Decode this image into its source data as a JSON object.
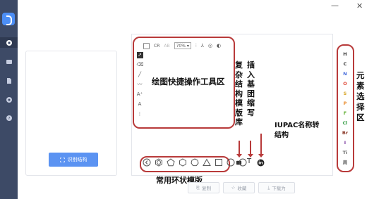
{
  "window": {
    "minimize_label": "—",
    "close_label": "✕"
  },
  "nav": {
    "items": [
      "home-icon",
      "folder-icon",
      "file-icon",
      "gear-icon",
      "help-icon"
    ]
  },
  "left_panel": {
    "recognize_button": "识别结构"
  },
  "editor": {
    "zoom": "70%",
    "elements": [
      "H",
      "C",
      "N",
      "O",
      "S",
      "P",
      "F",
      "Cl",
      "Br",
      "I",
      "Ti",
      "周"
    ],
    "element_colors": {
      "H": "#333333",
      "C": "#333333",
      "N": "#3a62d8",
      "O": "#e04a3a",
      "S": "#d6a322",
      "P": "#e98a2a",
      "F": "#66b23a",
      "Cl": "#3aa04a",
      "Br": "#8b3a2a",
      "I": "#7a3aa0",
      "Ti": "#666666",
      "周": "#666666"
    }
  },
  "annotations": {
    "toolbar": "绘图快捷操作工具区",
    "template_lib": "复杂结构模版库",
    "abbr": "插入基团缩写",
    "iupac": "IUPAC名称转结构",
    "elements": "元素选择区",
    "rings": "常用环状模版"
  },
  "actions": {
    "copy": "复制",
    "save": "收藏",
    "download": "下载为"
  },
  "accent": "#5b93f2",
  "highlight": "#b83a3a"
}
